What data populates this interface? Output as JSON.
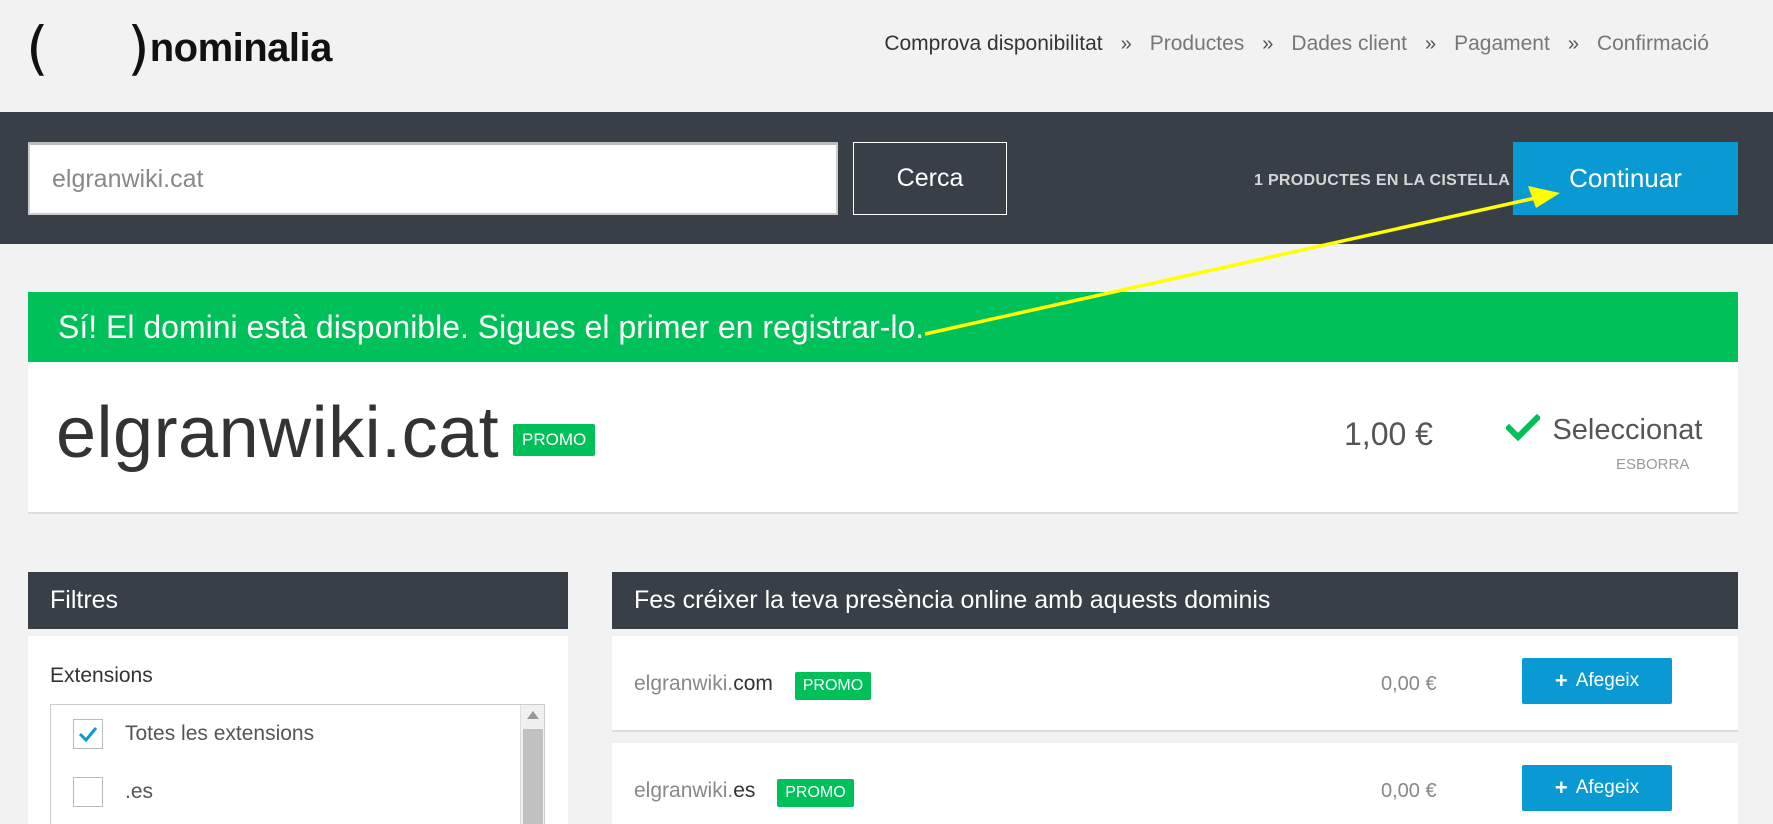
{
  "logo": {
    "parens": "( )",
    "text": "nominalia"
  },
  "steps": [
    {
      "label": "Comprova disponibilitat",
      "active": true
    },
    {
      "label": "Productes"
    },
    {
      "label": "Dades client"
    },
    {
      "label": "Pagament"
    },
    {
      "label": "Confirmació"
    }
  ],
  "step_separator": "»",
  "search": {
    "value": "elgranwiki.cat",
    "button": "Cerca"
  },
  "cart": {
    "count_label": "1 PRODUCTES EN LA CISTELLA",
    "continue": "Continuar"
  },
  "banner": "Sí! El domini està disponible. Sigues el primer en registrar-lo.",
  "result": {
    "domain": "elgranwiki.cat",
    "badge": "PROMO",
    "price": "1,00 €",
    "selected": "Seleccionat",
    "remove": "ESBORRA"
  },
  "filters": {
    "title": "Filtres",
    "extensions_title": "Extensions",
    "items": [
      {
        "label": "Totes les extensions",
        "checked": true
      },
      {
        "label": ".es",
        "checked": false
      }
    ]
  },
  "suggestions": {
    "title": "Fes créixer la teva presència online amb aquests dominis",
    "rows": [
      {
        "name": "elgranwiki.",
        "tld": "com",
        "badge": "PROMO",
        "price": "0,00 €",
        "button": "Afegeix"
      },
      {
        "name": "elgranwiki.",
        "tld": "es",
        "badge": "PROMO",
        "price": "0,00 €",
        "button": "Afegeix"
      }
    ]
  },
  "colors": {
    "dark": "#383f47",
    "accent_blue": "#0a9ad3",
    "green": "#00c05a",
    "annotation_arrow": "#ffff00"
  },
  "icons": [
    "check-icon",
    "plus-icon",
    "scroll-up-icon"
  ]
}
